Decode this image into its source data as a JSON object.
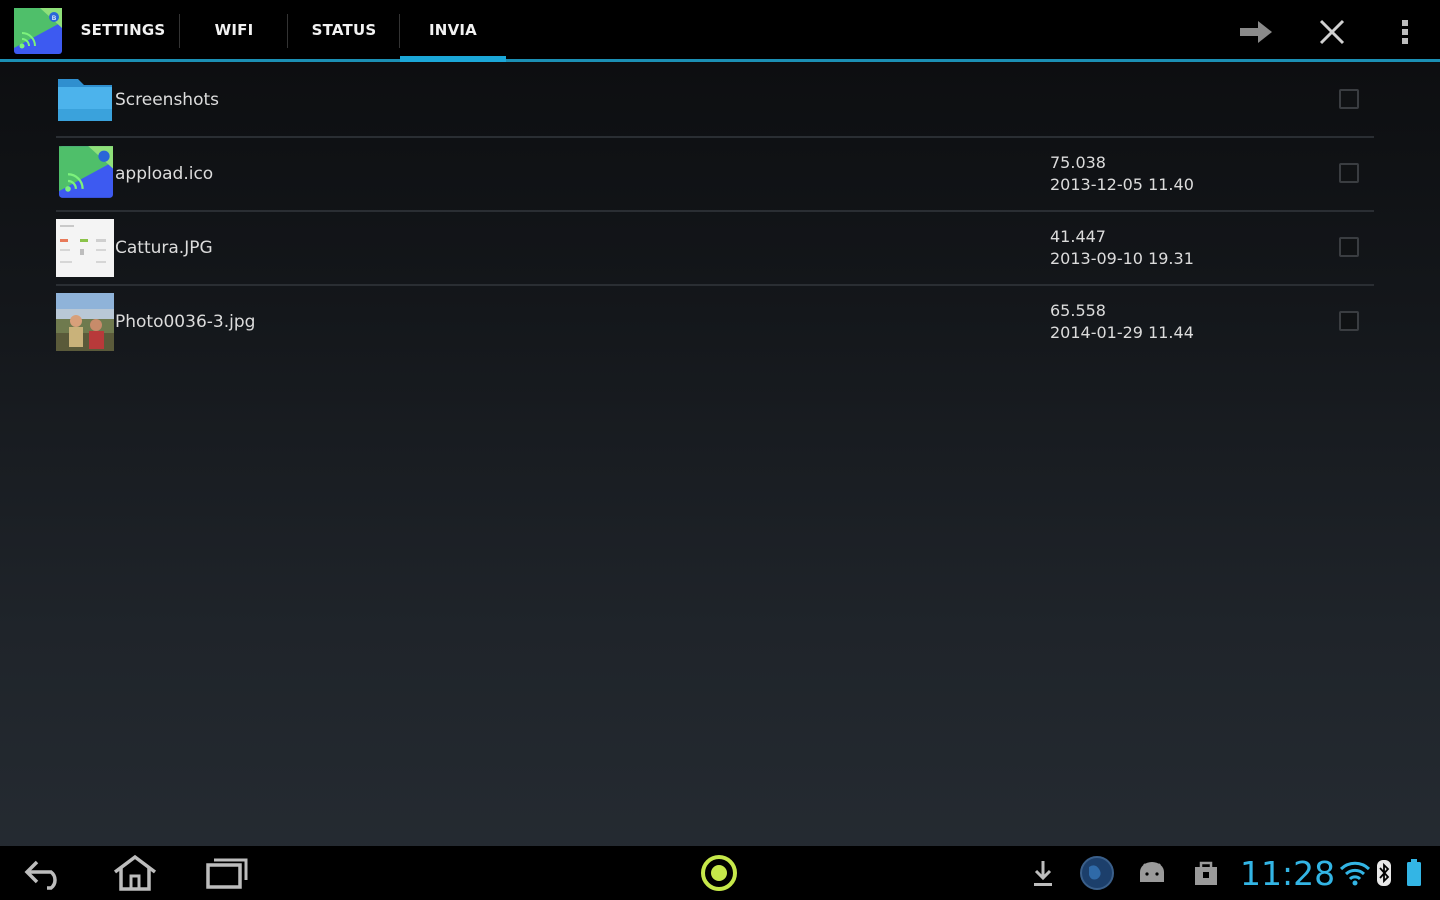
{
  "tabs": [
    {
      "label": "SETTINGS",
      "active": false
    },
    {
      "label": "WIFI",
      "active": false
    },
    {
      "label": "STATUS",
      "active": false
    },
    {
      "label": "INVIA",
      "active": true
    }
  ],
  "actions": {
    "send_icon": "arrow-right-icon",
    "close_icon": "close-icon",
    "overflow_icon": "overflow-menu-icon"
  },
  "files": [
    {
      "name": "Screenshots",
      "type": "folder",
      "size": "",
      "date": "",
      "checked": false
    },
    {
      "name": "appload.ico",
      "type": "app-icon",
      "size": "75.038",
      "date": "2013-12-05 11.40",
      "checked": false
    },
    {
      "name": "Cattura.JPG",
      "type": "image-screenshot",
      "size": "41.447",
      "date": "2013-09-10 19.31",
      "checked": false
    },
    {
      "name": "Photo0036-3.jpg",
      "type": "image-photo",
      "size": "65.558",
      "date": "2014-01-29 11.44",
      "checked": false
    }
  ],
  "status": {
    "time": "11:28"
  },
  "colors": {
    "accent": "#33b5e5",
    "tab_indicator": "#1ba7d8",
    "background": "#14171b"
  }
}
